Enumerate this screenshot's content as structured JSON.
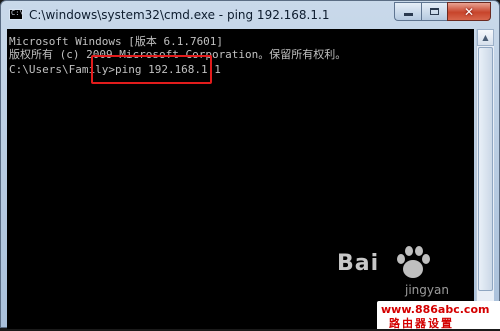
{
  "window": {
    "title": "C:\\windows\\system32\\cmd.exe - ping  192.168.1.1",
    "icon_text": "C:\\"
  },
  "console": {
    "lines": [
      "Microsoft Windows [版本 6.1.7601]",
      "版权所有 (c) 2009 Microsoft Corporation。保留所有权利。",
      "",
      "C:\\Users\\Family>ping 192.168.1.1"
    ]
  },
  "colors": {
    "console_bg": "#000000",
    "console_text": "#c0c0c0",
    "highlight_box": "#e21c1c",
    "close_button": "#c7442b"
  },
  "icons": {
    "minimize": "minimize-icon",
    "maximize": "maximize-icon",
    "close": "close-icon",
    "scroll_up": "scroll-up-icon",
    "scroll_down": "scroll-down-icon"
  },
  "watermark": {
    "baidu_text": "Bai",
    "jingyan_text": "jingyan"
  },
  "banner": {
    "url": "www.886abc.com",
    "name": "路由器设置"
  }
}
